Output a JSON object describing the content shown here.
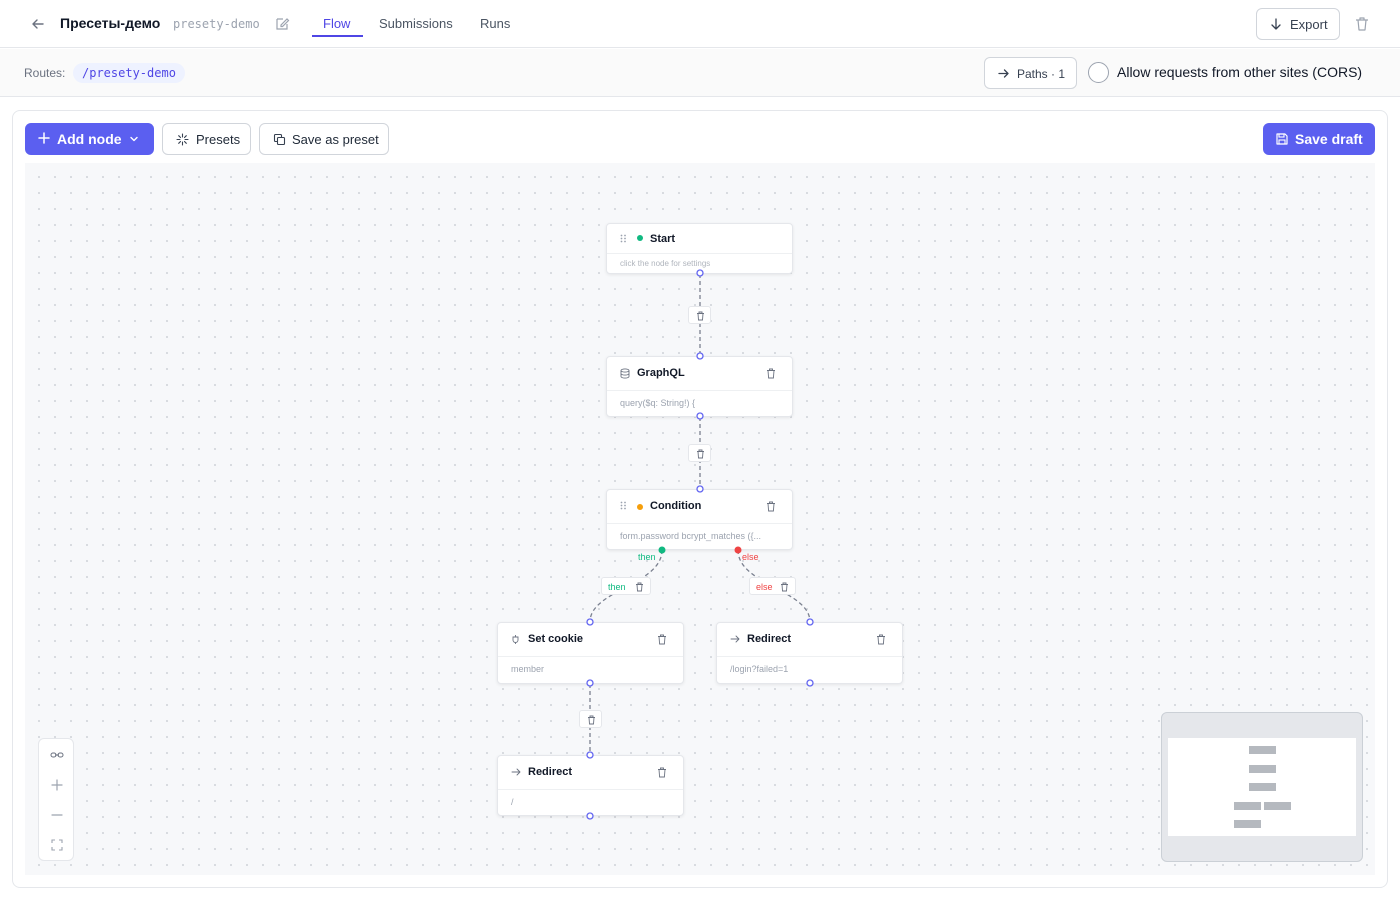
{
  "header": {
    "title": "Пресеты-демо",
    "slug": "presety-demo",
    "tabs": [
      "Flow",
      "Submissions",
      "Runs"
    ],
    "active_tab": "Flow",
    "export_label": "Export"
  },
  "routes": {
    "label": "Routes:",
    "path": "/presety-demo",
    "paths_label": "Paths · 1",
    "cors_label": "Allow requests from other sites (CORS)",
    "cors_checked": false
  },
  "toolbar": {
    "add_node_label": "Add node",
    "presets_label": "Presets",
    "save_as_preset_label": "Save as preset",
    "save_draft_label": "Save draft"
  },
  "nodes": {
    "start": {
      "title": "Start",
      "body": "click the node for settings",
      "status": "#10b981"
    },
    "graphql": {
      "title": "GraphQL",
      "body": "query($q: String!) {"
    },
    "condition": {
      "title": "Condition",
      "body": "form.password bcrypt_matches ({...",
      "status": "#f59e0b",
      "then_label": "then",
      "else_label": "else"
    },
    "set_cookie": {
      "title": "Set cookie",
      "body": "member"
    },
    "redirect_fail": {
      "title": "Redirect",
      "body": "/login?failed=1"
    },
    "redirect_ok": {
      "title": "Redirect",
      "body": "/"
    }
  },
  "edges": {
    "then_label": "then",
    "else_label": "else"
  },
  "colors": {
    "accent": "#5b5ff0",
    "then": "#10b981",
    "else": "#ef4444",
    "handle": "#6366f1"
  },
  "icons": [
    "arrow-left-icon",
    "edit-icon",
    "arrow-down-icon",
    "trash-icon",
    "arrow-right-icon",
    "plus-icon",
    "chevron-down-icon",
    "sparkle-icon",
    "copy-icon",
    "save-icon",
    "grip-icon",
    "database-icon",
    "cookie-icon",
    "link-icon",
    "minus-icon",
    "fullscreen-icon"
  ]
}
